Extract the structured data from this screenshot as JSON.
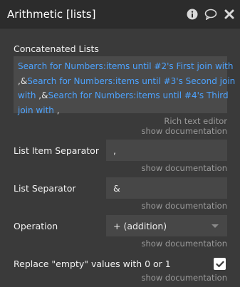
{
  "header": {
    "title": "Arithmetic [lists]",
    "icons": [
      "info-icon",
      "comment-icon",
      "close-icon"
    ]
  },
  "concatenated": {
    "label": "Concatenated Lists",
    "lines": [
      [
        {
          "t": "Search for Numbers:items until #2's First join with",
          "c": "expr"
        }
      ],
      [
        {
          "t": ",",
          "c": "sep"
        },
        {
          "t": "&",
          "c": "sep"
        },
        {
          "t": "Search for Numbers:items until #3's Second join",
          "c": "expr"
        }
      ],
      [
        {
          "t": "with ",
          "c": "expr"
        },
        {
          "t": ",",
          "c": "sep"
        },
        {
          "t": "&",
          "c": "sep"
        },
        {
          "t": "Search for Numbers:items until #4's Third",
          "c": "expr"
        }
      ],
      [
        {
          "t": "join with ",
          "c": "expr"
        },
        {
          "t": ",",
          "c": "sep"
        }
      ]
    ],
    "editor_type": "Rich text editor",
    "doc_link": "show documentation"
  },
  "list_item_separator": {
    "label": "List Item Separator",
    "value": ",",
    "doc_link": "show documentation"
  },
  "list_separator": {
    "label": "List Separator",
    "value": "&",
    "doc_link": "show documentation"
  },
  "operation": {
    "label": "Operation",
    "selected": "+ (addition)",
    "doc_link": "show documentation"
  },
  "replace_empty": {
    "label": "Replace \"empty\" values with 0 or 1",
    "checked": true,
    "doc_link": "show documentation"
  },
  "colors": {
    "expression": "#4da3ff",
    "background": "#3a3a3a",
    "header": "#2c2c2c"
  }
}
